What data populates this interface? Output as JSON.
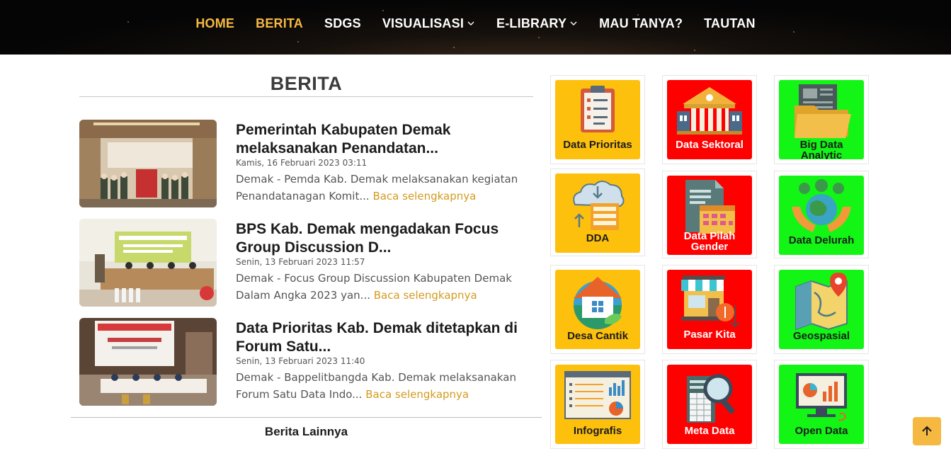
{
  "nav": {
    "items": [
      {
        "label": "HOME",
        "active": true,
        "dropdown": false
      },
      {
        "label": "BERITA",
        "active": true,
        "dropdown": false
      },
      {
        "label": "SDGS",
        "active": false,
        "dropdown": false
      },
      {
        "label": "VISUALISASI",
        "active": false,
        "dropdown": true
      },
      {
        "label": "E-LIBRARY",
        "active": false,
        "dropdown": true
      },
      {
        "label": "MAU TANYA?",
        "active": false,
        "dropdown": false
      },
      {
        "label": "TAUTAN",
        "active": false,
        "dropdown": false
      }
    ],
    "active_color": "#f5b942"
  },
  "berita": {
    "title": "BERITA",
    "items": [
      {
        "headline": "Pemerintah Kabupaten Demak melaksanakan Penandatan...",
        "date": "Kamis, 16 Februari 2023 03:11",
        "excerpt": "Demak - Pemda Kab. Demak melaksanakan kegiatan Penandatanagan Komit...",
        "more": "Baca selengkapnya"
      },
      {
        "headline": "BPS Kab. Demak mengadakan Focus Group Discussion D...",
        "date": "Senin, 13 Februari 2023 11:57",
        "excerpt": "Demak - Focus Group Discussion Kabupaten Demak Dalam Angka 2023 yan...",
        "more": "Baca selengkapnya"
      },
      {
        "headline": "Data Prioritas Kab. Demak ditetapkan di Forum Satu...",
        "date": "Senin, 13 Februari 2023 11:40",
        "excerpt": "Demak - Bappelitbangda Kab. Demak melaksanakan Forum Satu Data Indo...",
        "more": "Baca selengkapnya"
      }
    ],
    "more_label": "Berita Lainnya"
  },
  "tiles": [
    {
      "label": "Data Prioritas",
      "color": "#fcc00d",
      "icon": "clipboard-checklist-icon"
    },
    {
      "label": "Data Sektoral",
      "color": "#ff0000",
      "icon": "government-building-icon"
    },
    {
      "label": "Big Data Analytic",
      "color": "#12f515",
      "icon": "folder-document-icon"
    },
    {
      "label": "DDA",
      "color": "#fcc00d",
      "icon": "cloud-server-icon"
    },
    {
      "label": "Data Pilah Gender",
      "color": "#ff0000",
      "icon": "document-calendar-icon"
    },
    {
      "label": "Data Delurah",
      "color": "#12f515",
      "icon": "hands-earth-icon"
    },
    {
      "label": "Desa Cantik",
      "color": "#fcc00d",
      "icon": "village-house-icon"
    },
    {
      "label": "Pasar Kita",
      "color": "#ff0000",
      "icon": "market-shop-icon"
    },
    {
      "label": "Geospasial",
      "color": "#12f515",
      "icon": "map-pin-icon"
    },
    {
      "label": "Infografis",
      "color": "#fcc00d",
      "icon": "infographic-board-icon"
    },
    {
      "label": "Meta Data",
      "color": "#ff0000",
      "icon": "magnifier-spreadsheet-icon"
    },
    {
      "label": "Open Data",
      "color": "#12f515",
      "icon": "monitor-chart-icon"
    }
  ]
}
